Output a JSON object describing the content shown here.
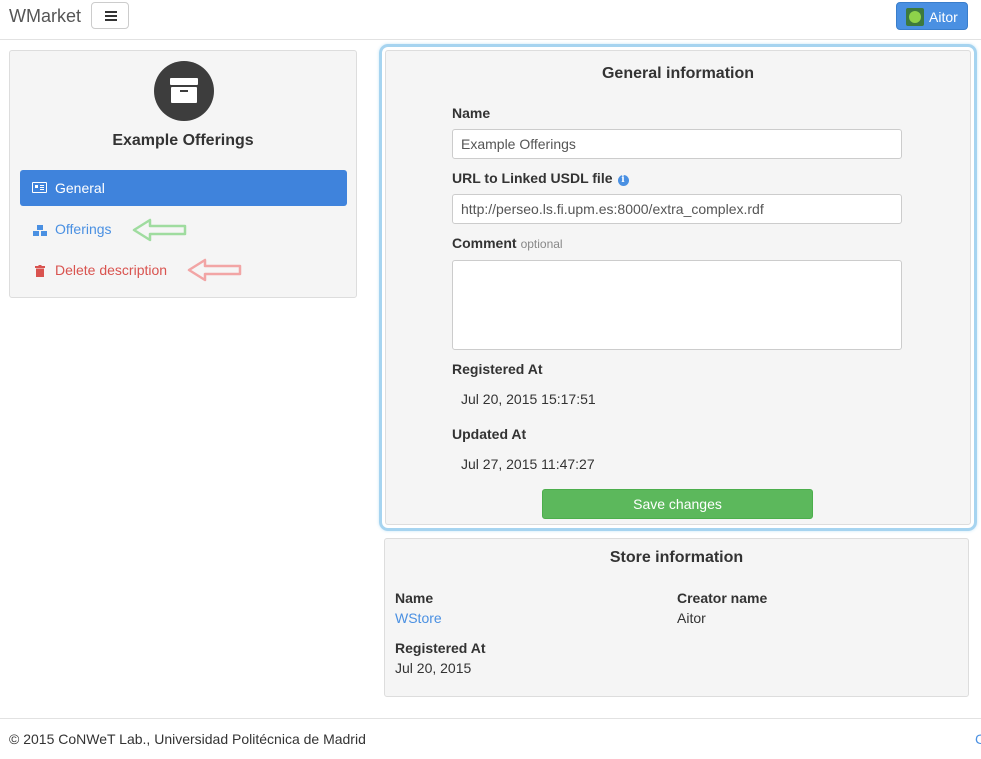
{
  "app": {
    "brand": "WMarket",
    "user_name": "Aitor"
  },
  "sidebar": {
    "title": "Example Offerings",
    "items": [
      {
        "label": "General",
        "icon": "id-card-icon",
        "active": true
      },
      {
        "label": "Offerings",
        "icon": "cubes-icon"
      },
      {
        "label": "Delete description",
        "icon": "trash-icon"
      }
    ]
  },
  "general": {
    "heading": "General information",
    "name_label": "Name",
    "name_value": "Example Offerings",
    "url_label": "URL to Linked USDL file",
    "url_value": "http://perseo.ls.fi.upm.es:8000/extra_complex.rdf",
    "comment_label": "Comment",
    "comment_optional": "optional",
    "comment_value": "",
    "registered_label": "Registered At",
    "registered_value": "Jul 20, 2015 15:17:51",
    "updated_label": "Updated At",
    "updated_value": "Jul 27, 2015 11:47:27",
    "save_label": "Save changes"
  },
  "store": {
    "heading": "Store information",
    "name_label": "Name",
    "name_value": "WStore",
    "creator_label": "Creator name",
    "creator_value": "Aitor",
    "registered_label": "Registered At",
    "registered_value": "Jul 20, 2015"
  },
  "footer": {
    "copyright": "© 2015 CoNWeT Lab., Universidad Politécnica de Madrid",
    "right_fragment": "C"
  },
  "colors": {
    "primary": "#3f83dc",
    "success": "#5cb85c",
    "danger": "#d9534f",
    "link": "#4a90e2",
    "highlight_border": "#a6d4f0"
  }
}
